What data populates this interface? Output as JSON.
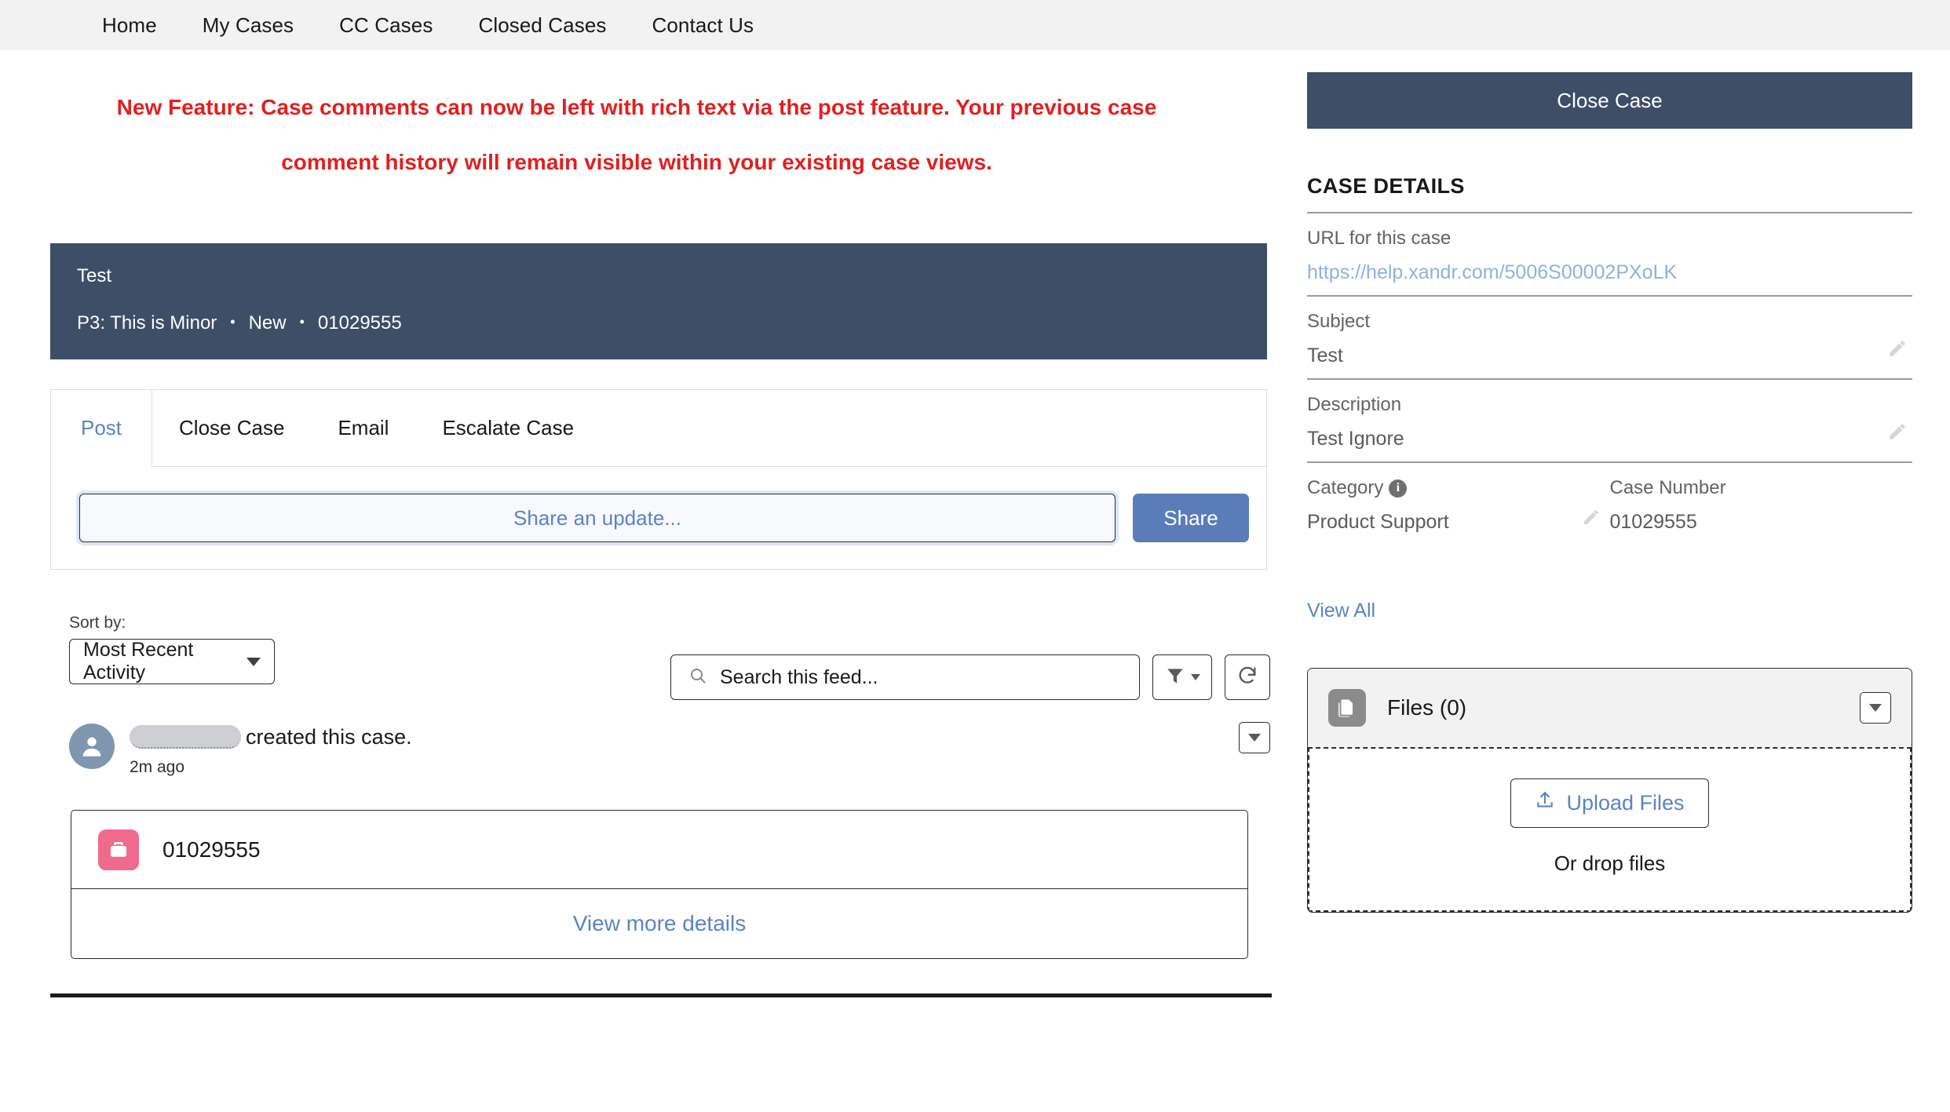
{
  "nav": {
    "items": [
      {
        "label": "Home"
      },
      {
        "label": "My Cases"
      },
      {
        "label": "CC Cases"
      },
      {
        "label": "Closed Cases"
      },
      {
        "label": "Contact Us"
      }
    ]
  },
  "banner": {
    "line1": "New Feature: Case comments can now be left with rich text via the post feature. Your previous case",
    "line2": "comment history will remain visible within your existing case views.",
    "color": "#e02020"
  },
  "case_header": {
    "title": "Test",
    "priority": "P3: This is Minor",
    "status": "New",
    "case_number": "01029555",
    "separator": "•",
    "background": "#3d4e66"
  },
  "publisher": {
    "tabs": [
      {
        "label": "Post",
        "active": true
      },
      {
        "label": "Close Case",
        "active": false
      },
      {
        "label": "Email",
        "active": false
      },
      {
        "label": "Escalate Case",
        "active": false
      }
    ],
    "share_placeholder": "Share an update...",
    "share_button": "Share",
    "share_button_color": "#5a7cb8"
  },
  "feed_controls": {
    "sort_label": "Sort by:",
    "sort_value": "Most Recent Activity",
    "search_placeholder": "Search this feed...",
    "search_value": "",
    "search_icon": "search-icon",
    "filter_icon": "filter-icon",
    "refresh_icon": "refresh-icon"
  },
  "feed_item": {
    "actor_name": "",
    "action_text": "created this case.",
    "timestamp": "2m ago",
    "menu_icon": "chevron-down-icon"
  },
  "record_card": {
    "icon": "briefcase-icon",
    "icon_color": "#f06a8e",
    "record_number": "01029555",
    "footer_link": "View more details"
  },
  "sidebar": {
    "close_case_button": "Close Case",
    "section_title": "CASE DETAILS",
    "fields": [
      {
        "label": "URL for this case",
        "value": "https://help.xandr.com/5006S00002PXoLK",
        "is_link": true,
        "editable": false
      },
      {
        "label": "Subject",
        "value": "Test",
        "is_link": false,
        "editable": true
      },
      {
        "label": "Description",
        "value": "Test Ignore",
        "is_link": false,
        "editable": true
      }
    ],
    "category": {
      "label": "Category",
      "value": "Product Support",
      "info_icon": "info-icon",
      "editable": true
    },
    "case_number": {
      "label": "Case Number",
      "value": "01029555"
    },
    "view_all": "View All"
  },
  "files": {
    "icon": "files-icon",
    "title": "Files (0)",
    "toggle_icon": "chevron-down-icon",
    "upload_button": "Upload Files",
    "upload_icon": "upload-icon",
    "drop_text": "Or drop files"
  }
}
